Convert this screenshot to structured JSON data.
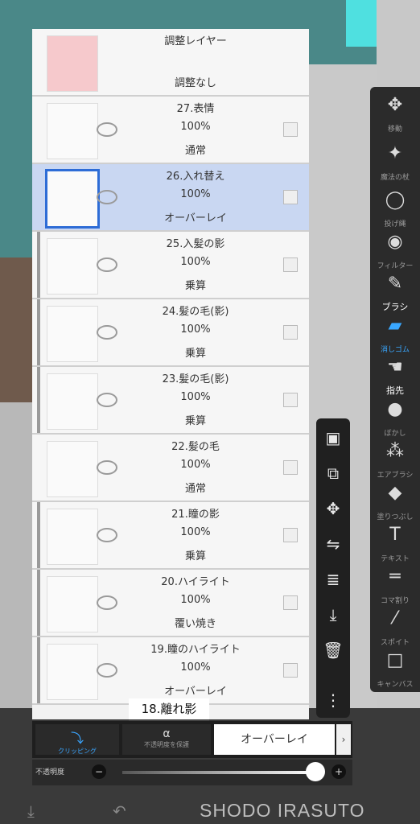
{
  "layers": [
    {
      "name": "調整レイヤー",
      "opacity": "",
      "blend": "調整なし",
      "thumb": "pink",
      "clip": false,
      "selected": false
    },
    {
      "name": "27.表情",
      "opacity": "100%",
      "blend": "通常",
      "thumb": "sketch",
      "clip": false,
      "selected": false
    },
    {
      "name": "26.入れ替え",
      "opacity": "100%",
      "blend": "オーバーレイ",
      "thumb": "stroke",
      "clip": false,
      "selected": true
    },
    {
      "name": "25.入髪の影",
      "opacity": "100%",
      "blend": "乗算",
      "thumb": "blank",
      "clip": true,
      "selected": false
    },
    {
      "name": "24.髪の毛(影)",
      "opacity": "100%",
      "blend": "乗算",
      "thumb": "hair",
      "clip": true,
      "selected": false
    },
    {
      "name": "23.髪の毛(影)",
      "opacity": "100%",
      "blend": "乗算",
      "thumb": "sketch",
      "clip": true,
      "selected": false
    },
    {
      "name": "22.髪の毛",
      "opacity": "100%",
      "blend": "通常",
      "thumb": "hair",
      "clip": false,
      "selected": false
    },
    {
      "name": "21.瞳の影",
      "opacity": "100%",
      "blend": "乗算",
      "thumb": "blank",
      "clip": true,
      "selected": false
    },
    {
      "name": "20.ハイライト",
      "opacity": "100%",
      "blend": "覆い焼き",
      "thumb": "blank",
      "clip": true,
      "selected": false
    },
    {
      "name": "19.瞳のハイライト",
      "opacity": "100%",
      "blend": "オーバーレイ",
      "thumb": "blank",
      "clip": true,
      "selected": false
    }
  ],
  "caption": "18.離れ影",
  "tools": [
    {
      "label": "移動",
      "icon": "move-icon"
    },
    {
      "label": "魔法の杖",
      "icon": "magic-wand-icon"
    },
    {
      "label": "投げ縄",
      "icon": "lasso-icon"
    },
    {
      "label": "フィルター",
      "icon": "filter-icon"
    },
    {
      "label": "ブラシ",
      "icon": "brush-icon"
    },
    {
      "label": "消しゴム",
      "icon": "eraser-icon"
    },
    {
      "label": "指先",
      "icon": "smudge-icon"
    },
    {
      "label": "ぼかし",
      "icon": "blur-icon"
    },
    {
      "label": "エアブラシ",
      "icon": "airbrush-icon"
    },
    {
      "label": "塗りつぶし",
      "icon": "fill-icon"
    },
    {
      "label": "テキスト",
      "icon": "text-icon"
    },
    {
      "label": "コマ割り",
      "icon": "frame-icon"
    },
    {
      "label": "スポイト",
      "icon": "eyedropper-icon"
    },
    {
      "label": "キャンバス",
      "icon": "canvas-icon"
    }
  ],
  "bottom": {
    "clipping_label": "クリッピング",
    "alpha_label": "不透明度を保護",
    "blend_mode": "オーバーレイ",
    "opacity_label": "不透明度",
    "opacity_value": 1.0
  },
  "watermark": "SHODO IRASUTO"
}
